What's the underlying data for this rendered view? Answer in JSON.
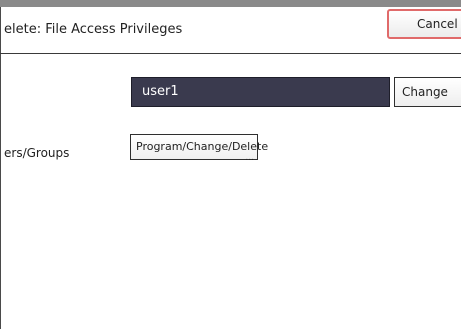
{
  "header": {
    "title": "elete: File Access Privileges",
    "cancel_label": "Cancel"
  },
  "user": {
    "value": "user1",
    "change_label": "Change"
  },
  "privileges": {
    "label": "ers/Groups",
    "program_label": "Program/Change/Delete",
    "more_indicator": "..."
  },
  "colors": {
    "field_background": "#3a3a4e",
    "cancel_border": "#e06a6a"
  }
}
